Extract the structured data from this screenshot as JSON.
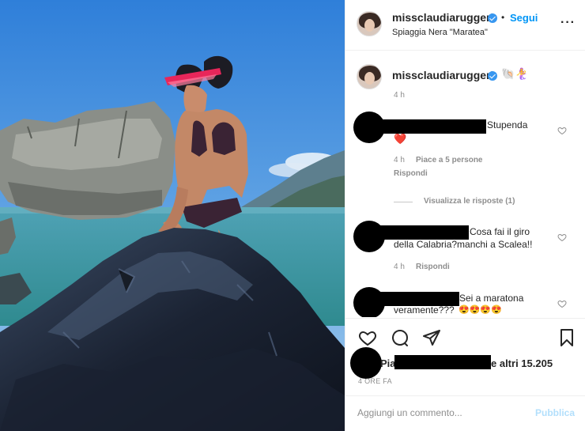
{
  "post": {
    "username": "missclaudiaruggeri",
    "separator": "•",
    "follow_label": "Segui",
    "location": "Spiaggia Nera \"Maratea\"",
    "more_icon": "more-options-icon"
  },
  "caption": {
    "username": "missclaudiaruggeri",
    "emojis": "🐚🧜‍♀️",
    "time": "4 h"
  },
  "comments": [
    {
      "text": "Stupenda",
      "emoji": "❤️",
      "time": "4 h",
      "likes": "Piace a 5 persone",
      "reply": "Rispondi",
      "view_replies": "Visualizza le risposte (1)"
    },
    {
      "text_line1": "Cosa fai il giro",
      "text_line2": "della Calabria?manchi a Scalea!!",
      "time": "4 h",
      "reply": "Rispondi"
    },
    {
      "text_line1": "Sei a maratona",
      "text_line2": "veramente???",
      "emojis": "😍😍😍😍"
    }
  ],
  "likes_prefix": "Piac",
  "likes_suffix": "e altri 15.205",
  "post_time": "4 ORE FA",
  "add_comment": {
    "placeholder": "Aggiungi un commento...",
    "publish": "Pubblica"
  },
  "colors": {
    "accent": "#0095f6",
    "publish_disabled": "#b2dffc",
    "verified": "#3897f0"
  }
}
